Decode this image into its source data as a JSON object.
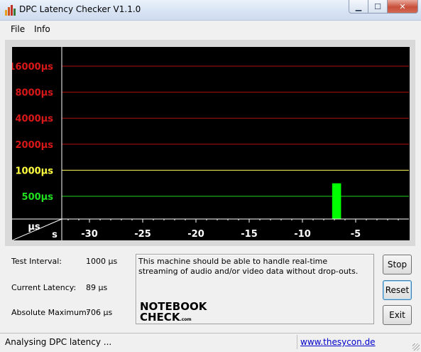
{
  "window": {
    "title": "DPC Latency Checker V1.1.0",
    "icon": "bar-chart-icon"
  },
  "menu": {
    "items": [
      "File",
      "Info"
    ]
  },
  "chart_data": {
    "type": "bar",
    "ylabel": "µs",
    "xlabel": "s",
    "y_ticks": [
      {
        "label": "16000µs",
        "color": "#d81818"
      },
      {
        "label": "8000µs",
        "color": "#d81818"
      },
      {
        "label": "4000µs",
        "color": "#d81818"
      },
      {
        "label": "2000µs",
        "color": "#d81818"
      },
      {
        "label": "1000µs",
        "color": "#ffff40"
      },
      {
        "label": "500µs",
        "color": "#20e020"
      }
    ],
    "x_ticks": [
      "-30",
      "-25",
      "-20",
      "-15",
      "-10",
      "-5"
    ],
    "bar_color": "#00ff00",
    "values": [
      89,
      80,
      78,
      78,
      80,
      89,
      85,
      82,
      80,
      78,
      80,
      78,
      80,
      82,
      85,
      80,
      89,
      106,
      85,
      78,
      110,
      90,
      84,
      85,
      84,
      80,
      85,
      89,
      706,
      80,
      78,
      85,
      89,
      80,
      85,
      82
    ]
  },
  "info": {
    "test_interval_label": "Test Interval:",
    "test_interval_value": "1000 µs",
    "current_latency_label": "Current Latency:",
    "current_latency_value": "89 µs",
    "absolute_maximum_label": "Absolute Maximum:",
    "absolute_maximum_value": "706 µs"
  },
  "message": "This machine should be able to handle real-time streaming of audio and/or video data without drop-outs.",
  "logo": {
    "line1": "NOTEBOOK",
    "line2": "CHECK",
    "suffix": ".com"
  },
  "buttons": {
    "stop": "Stop",
    "reset": "Reset",
    "exit": "Exit"
  },
  "status": {
    "text": "Analysing DPC latency ...",
    "link": "www.thesycon.de"
  }
}
